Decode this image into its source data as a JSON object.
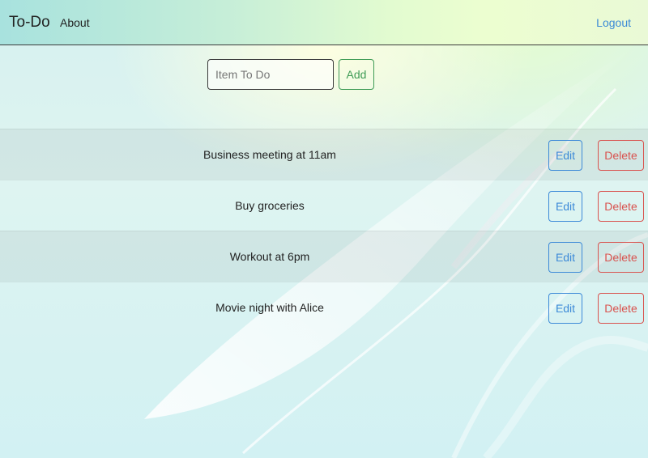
{
  "navbar": {
    "brand": "To-Do",
    "about_label": "About",
    "logout_label": "Logout"
  },
  "add_form": {
    "placeholder": "Item To Do",
    "value": "",
    "add_label": "Add"
  },
  "todos": [
    {
      "text": "Business meeting at 11am",
      "edit_label": "Edit",
      "delete_label": "Delete"
    },
    {
      "text": "Buy groceries",
      "edit_label": "Edit",
      "delete_label": "Delete"
    },
    {
      "text": "Workout at 6pm",
      "edit_label": "Edit",
      "delete_label": "Delete"
    },
    {
      "text": "Movie night with Alice",
      "edit_label": "Edit",
      "delete_label": "Delete"
    }
  ],
  "colors": {
    "primary": "#3d8ad8",
    "success": "#3e9b55",
    "danger": "#d9534f"
  }
}
